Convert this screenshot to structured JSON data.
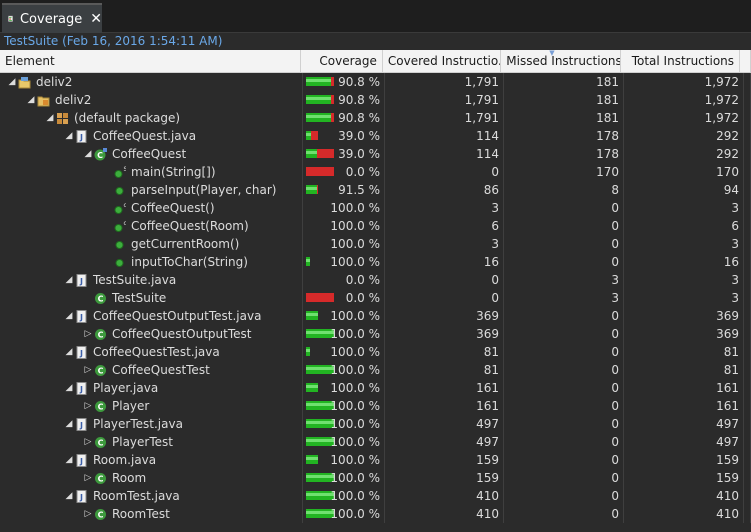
{
  "tab": {
    "label": "Coverage"
  },
  "session": "TestSuite (Feb 16, 2016 1:54:11 AM)",
  "columns": {
    "element": "Element",
    "coverage": "Coverage",
    "covered": "Covered Instructio...",
    "missed": "Missed Instructions",
    "total": "Total Instructions"
  },
  "rows": [
    {
      "indent": 0,
      "expander": "expanded",
      "icon": "project-icon",
      "name": "deliv2",
      "bar": "full",
      "coverage": 0.908,
      "pct": "90.8 %",
      "covered": "1,791",
      "missed": "181",
      "total": "1,972"
    },
    {
      "indent": 1,
      "expander": "expanded",
      "icon": "source-folder-icon",
      "name": "deliv2",
      "bar": "full",
      "coverage": 0.908,
      "pct": "90.8 %",
      "covered": "1,791",
      "missed": "181",
      "total": "1,972"
    },
    {
      "indent": 2,
      "expander": "expanded",
      "icon": "package-icon",
      "name": "(default package)",
      "bar": "full",
      "coverage": 0.908,
      "pct": "90.8 %",
      "covered": "1,791",
      "missed": "181",
      "total": "1,972"
    },
    {
      "indent": 3,
      "expander": "expanded",
      "icon": "java-file-icon",
      "name": "CoffeeQuest.java",
      "bar": "short",
      "coverage": 0.39,
      "pct": "39.0 %",
      "covered": "114",
      "missed": "178",
      "total": "292"
    },
    {
      "indent": 4,
      "expander": "expanded",
      "icon": "class-main-icon",
      "name": "CoffeeQuest",
      "bar": "full",
      "coverage": 0.39,
      "pct": "39.0 %",
      "covered": "114",
      "missed": "178",
      "total": "292"
    },
    {
      "indent": 5,
      "expander": "none",
      "icon": "static-method-icon",
      "name": "main(String[])",
      "bar": "full",
      "coverage": 0.0,
      "pct": "0.0 %",
      "covered": "0",
      "missed": "170",
      "total": "170"
    },
    {
      "indent": 5,
      "expander": "none",
      "icon": "method-icon",
      "name": "parseInput(Player, char)",
      "bar": "short",
      "coverage": 0.915,
      "pct": "91.5 %",
      "covered": "86",
      "missed": "8",
      "total": "94"
    },
    {
      "indent": 5,
      "expander": "none",
      "icon": "constructor-icon",
      "name": "CoffeeQuest()",
      "bar": "none",
      "coverage": 1.0,
      "pct": "100.0 %",
      "covered": "3",
      "missed": "0",
      "total": "3"
    },
    {
      "indent": 5,
      "expander": "none",
      "icon": "constructor-icon",
      "name": "CoffeeQuest(Room)",
      "bar": "none",
      "coverage": 1.0,
      "pct": "100.0 %",
      "covered": "6",
      "missed": "0",
      "total": "6"
    },
    {
      "indent": 5,
      "expander": "none",
      "icon": "method-icon",
      "name": "getCurrentRoom()",
      "bar": "none",
      "coverage": 1.0,
      "pct": "100.0 %",
      "covered": "3",
      "missed": "0",
      "total": "3"
    },
    {
      "indent": 5,
      "expander": "none",
      "icon": "method-icon",
      "name": "inputToChar(String)",
      "bar": "thin",
      "coverage": 1.0,
      "pct": "100.0 %",
      "covered": "16",
      "missed": "0",
      "total": "16"
    },
    {
      "indent": 3,
      "expander": "expanded",
      "icon": "java-file-icon",
      "name": "TestSuite.java",
      "bar": "none",
      "coverage": 0.0,
      "pct": "0.0 %",
      "covered": "0",
      "missed": "3",
      "total": "3"
    },
    {
      "indent": 4,
      "expander": "none",
      "icon": "class-icon",
      "name": "TestSuite",
      "bar": "full",
      "coverage": 0.0,
      "pct": "0.0 %",
      "covered": "0",
      "missed": "3",
      "total": "3"
    },
    {
      "indent": 3,
      "expander": "expanded",
      "icon": "java-file-icon",
      "name": "CoffeeQuestOutputTest.java",
      "bar": "short",
      "coverage": 1.0,
      "pct": "100.0 %",
      "covered": "369",
      "missed": "0",
      "total": "369"
    },
    {
      "indent": 4,
      "expander": "collapsed",
      "icon": "class-icon",
      "name": "CoffeeQuestOutputTest",
      "bar": "full",
      "coverage": 1.0,
      "pct": "100.0 %",
      "covered": "369",
      "missed": "0",
      "total": "369"
    },
    {
      "indent": 3,
      "expander": "expanded",
      "icon": "java-file-icon",
      "name": "CoffeeQuestTest.java",
      "bar": "thin",
      "coverage": 1.0,
      "pct": "100.0 %",
      "covered": "81",
      "missed": "0",
      "total": "81"
    },
    {
      "indent": 4,
      "expander": "collapsed",
      "icon": "class-icon",
      "name": "CoffeeQuestTest",
      "bar": "full",
      "coverage": 1.0,
      "pct": "100.0 %",
      "covered": "81",
      "missed": "0",
      "total": "81"
    },
    {
      "indent": 3,
      "expander": "expanded",
      "icon": "java-file-icon",
      "name": "Player.java",
      "bar": "short",
      "coverage": 1.0,
      "pct": "100.0 %",
      "covered": "161",
      "missed": "0",
      "total": "161"
    },
    {
      "indent": 4,
      "expander": "collapsed",
      "icon": "class-icon",
      "name": "Player",
      "bar": "full",
      "coverage": 1.0,
      "pct": "100.0 %",
      "covered": "161",
      "missed": "0",
      "total": "161"
    },
    {
      "indent": 3,
      "expander": "expanded",
      "icon": "java-file-icon",
      "name": "PlayerTest.java",
      "bar": "full",
      "coverage": 1.0,
      "pct": "100.0 %",
      "covered": "497",
      "missed": "0",
      "total": "497"
    },
    {
      "indent": 4,
      "expander": "collapsed",
      "icon": "class-icon",
      "name": "PlayerTest",
      "bar": "full",
      "coverage": 1.0,
      "pct": "100.0 %",
      "covered": "497",
      "missed": "0",
      "total": "497"
    },
    {
      "indent": 3,
      "expander": "expanded",
      "icon": "java-file-icon",
      "name": "Room.java",
      "bar": "short",
      "coverage": 1.0,
      "pct": "100.0 %",
      "covered": "159",
      "missed": "0",
      "total": "159"
    },
    {
      "indent": 4,
      "expander": "collapsed",
      "icon": "class-icon",
      "name": "Room",
      "bar": "full",
      "coverage": 1.0,
      "pct": "100.0 %",
      "covered": "159",
      "missed": "0",
      "total": "159"
    },
    {
      "indent": 3,
      "expander": "expanded",
      "icon": "java-file-icon",
      "name": "RoomTest.java",
      "bar": "full",
      "coverage": 1.0,
      "pct": "100.0 %",
      "covered": "410",
      "missed": "0",
      "total": "410"
    },
    {
      "indent": 4,
      "expander": "collapsed",
      "icon": "class-icon",
      "name": "RoomTest",
      "bar": "full",
      "coverage": 1.0,
      "pct": "100.0 %",
      "covered": "410",
      "missed": "0",
      "total": "410"
    }
  ]
}
